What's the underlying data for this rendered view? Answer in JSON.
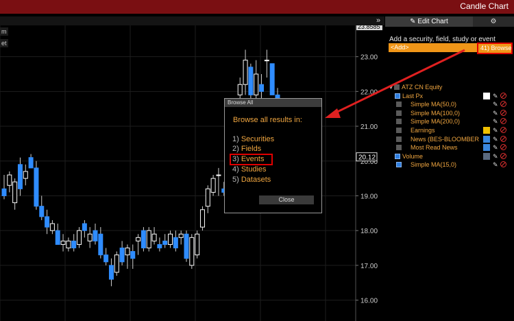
{
  "window": {
    "title": "Candle Chart"
  },
  "toolbar": {
    "collapse_glyph": "»"
  },
  "left_stubs": [
    "m",
    "et"
  ],
  "price_axis": {
    "ticks": [
      "23.00",
      "22.00",
      "21.00",
      "20.00",
      "19.00",
      "18.00",
      "17.00",
      "16.00"
    ],
    "high_label": "23.8585",
    "last_label": "20.12",
    "range": [
      15.4,
      23.9
    ]
  },
  "chart_data": {
    "type": "candlestick",
    "ylim": [
      15.4,
      23.9
    ],
    "colors": {
      "up": "#ffffff",
      "down": "#2f8cff"
    },
    "candles": [
      [
        19.2,
        19.6,
        18.9,
        19.0
      ],
      [
        19.3,
        19.7,
        19.1,
        19.6
      ],
      [
        18.8,
        19.5,
        18.6,
        19.4
      ],
      [
        19.9,
        20.1,
        19.0,
        19.2
      ],
      [
        19.5,
        19.9,
        19.3,
        19.7
      ],
      [
        20.1,
        20.2,
        19.8,
        19.8
      ],
      [
        19.8,
        20.0,
        18.6,
        18.7
      ],
      [
        18.7,
        19.0,
        18.3,
        18.4
      ],
      [
        18.4,
        18.6,
        17.9,
        18.1
      ],
      [
        18.0,
        18.3,
        17.9,
        18.2
      ],
      [
        18.0,
        18.2,
        17.6,
        17.6
      ],
      [
        17.6,
        17.9,
        17.4,
        17.7
      ],
      [
        17.5,
        17.8,
        17.4,
        17.7
      ],
      [
        17.7,
        17.9,
        17.4,
        17.5
      ],
      [
        17.6,
        18.1,
        17.5,
        18.0
      ],
      [
        18.2,
        18.3,
        17.8,
        18.0
      ],
      [
        17.7,
        18.1,
        17.5,
        17.9
      ],
      [
        18.0,
        18.2,
        17.6,
        17.7
      ],
      [
        17.9,
        18.1,
        17.2,
        17.3
      ],
      [
        17.3,
        17.5,
        17.0,
        17.1
      ],
      [
        17.0,
        17.2,
        16.4,
        16.6
      ],
      [
        16.8,
        17.4,
        16.7,
        17.3
      ],
      [
        17.5,
        17.7,
        17.0,
        17.1
      ],
      [
        17.3,
        17.6,
        16.9,
        17.5
      ],
      [
        17.4,
        17.6,
        16.9,
        17.2
      ],
      [
        17.7,
        17.9,
        17.3,
        17.8
      ],
      [
        18.0,
        18.1,
        17.4,
        17.5
      ],
      [
        17.5,
        18.1,
        17.4,
        18.0
      ],
      [
        17.7,
        18.1,
        17.6,
        17.9
      ],
      [
        17.6,
        17.8,
        17.4,
        17.5
      ],
      [
        17.7,
        17.9,
        17.5,
        17.6
      ],
      [
        17.6,
        18.0,
        17.5,
        17.9
      ],
      [
        17.8,
        18.0,
        17.4,
        17.5
      ],
      [
        17.8,
        18.0,
        17.6,
        17.9
      ],
      [
        17.9,
        18.0,
        17.1,
        17.2
      ],
      [
        17.0,
        17.9,
        16.9,
        17.8
      ],
      [
        17.3,
        18.0,
        17.2,
        17.9
      ],
      [
        18.1,
        18.7,
        18.0,
        18.6
      ],
      [
        18.7,
        19.3,
        18.5,
        19.2
      ],
      [
        19.1,
        19.6,
        19.0,
        19.5
      ],
      [
        19.6,
        19.8,
        19.0,
        19.6
      ],
      [
        19.2,
        19.4,
        19.0,
        19.1
      ],
      [
        19.5,
        19.7,
        19.3,
        19.6
      ],
      [
        20.0,
        20.5,
        19.8,
        20.3
      ],
      [
        21.9,
        22.4,
        21.5,
        22.2
      ],
      [
        22.2,
        23.2,
        21.9,
        22.9
      ],
      [
        22.7,
        22.8,
        21.8,
        21.9
      ],
      [
        21.9,
        22.9,
        21.8,
        22.5
      ],
      [
        22.2,
        22.5,
        21.8,
        22.0
      ],
      [
        22.9,
        23.2,
        22.4,
        22.9
      ],
      [
        22.8,
        22.8,
        21.9,
        21.9
      ],
      [
        21.9,
        22.1,
        21.6,
        21.8
      ]
    ]
  },
  "sidebar": {
    "tab_edit": "Edit Chart",
    "tab_edit_icon": "✎",
    "tab_settings_icon": "⚙",
    "add_label": "Add a security, field, study or event",
    "add_placeholder": "<Add>",
    "browse": "41) Browse",
    "tree": [
      {
        "label": "ATZ CN Equity",
        "indent": 0,
        "check": "none",
        "color": "#f0a640",
        "swatch": ""
      },
      {
        "label": "Last Px",
        "indent": 1,
        "check": "on",
        "color": "#f0a640",
        "swatch": "#ffffff"
      },
      {
        "label": "Simple MA(50,0)",
        "indent": 2,
        "check": "off",
        "color": "#f0a640",
        "swatch": ""
      },
      {
        "label": "Simple MA(100,0)",
        "indent": 2,
        "check": "off",
        "color": "#f0a640",
        "swatch": ""
      },
      {
        "label": "Simple MA(200,0)",
        "indent": 2,
        "check": "off",
        "color": "#f0a640",
        "swatch": ""
      },
      {
        "label": "Earnings",
        "indent": 2,
        "check": "off",
        "color": "#f0a640",
        "swatch": "#f0c000"
      },
      {
        "label": "News (BES-BLOOMBER",
        "indent": 2,
        "check": "off",
        "color": "#f0a640",
        "swatch": "#3a88e0"
      },
      {
        "label": "Most Read News",
        "indent": 2,
        "check": "off",
        "color": "#f0a640",
        "swatch": "#3a88e0"
      },
      {
        "label": "Volume",
        "indent": 1,
        "check": "on",
        "color": "#f0a640",
        "swatch": "#5a6a80"
      },
      {
        "label": "Simple MA(15,0)",
        "indent": 2,
        "check": "on",
        "color": "#f0a640",
        "swatch": ""
      }
    ]
  },
  "dialog": {
    "title": "Browse All",
    "heading": "Browse all results in:",
    "options": [
      {
        "num": "1)",
        "label": "Securities"
      },
      {
        "num": "2)",
        "label": "Fields"
      },
      {
        "num": "3)",
        "label": "Events"
      },
      {
        "num": "4)",
        "label": "Studies"
      },
      {
        "num": "5)",
        "label": "Datasets"
      }
    ],
    "close": "Close"
  }
}
